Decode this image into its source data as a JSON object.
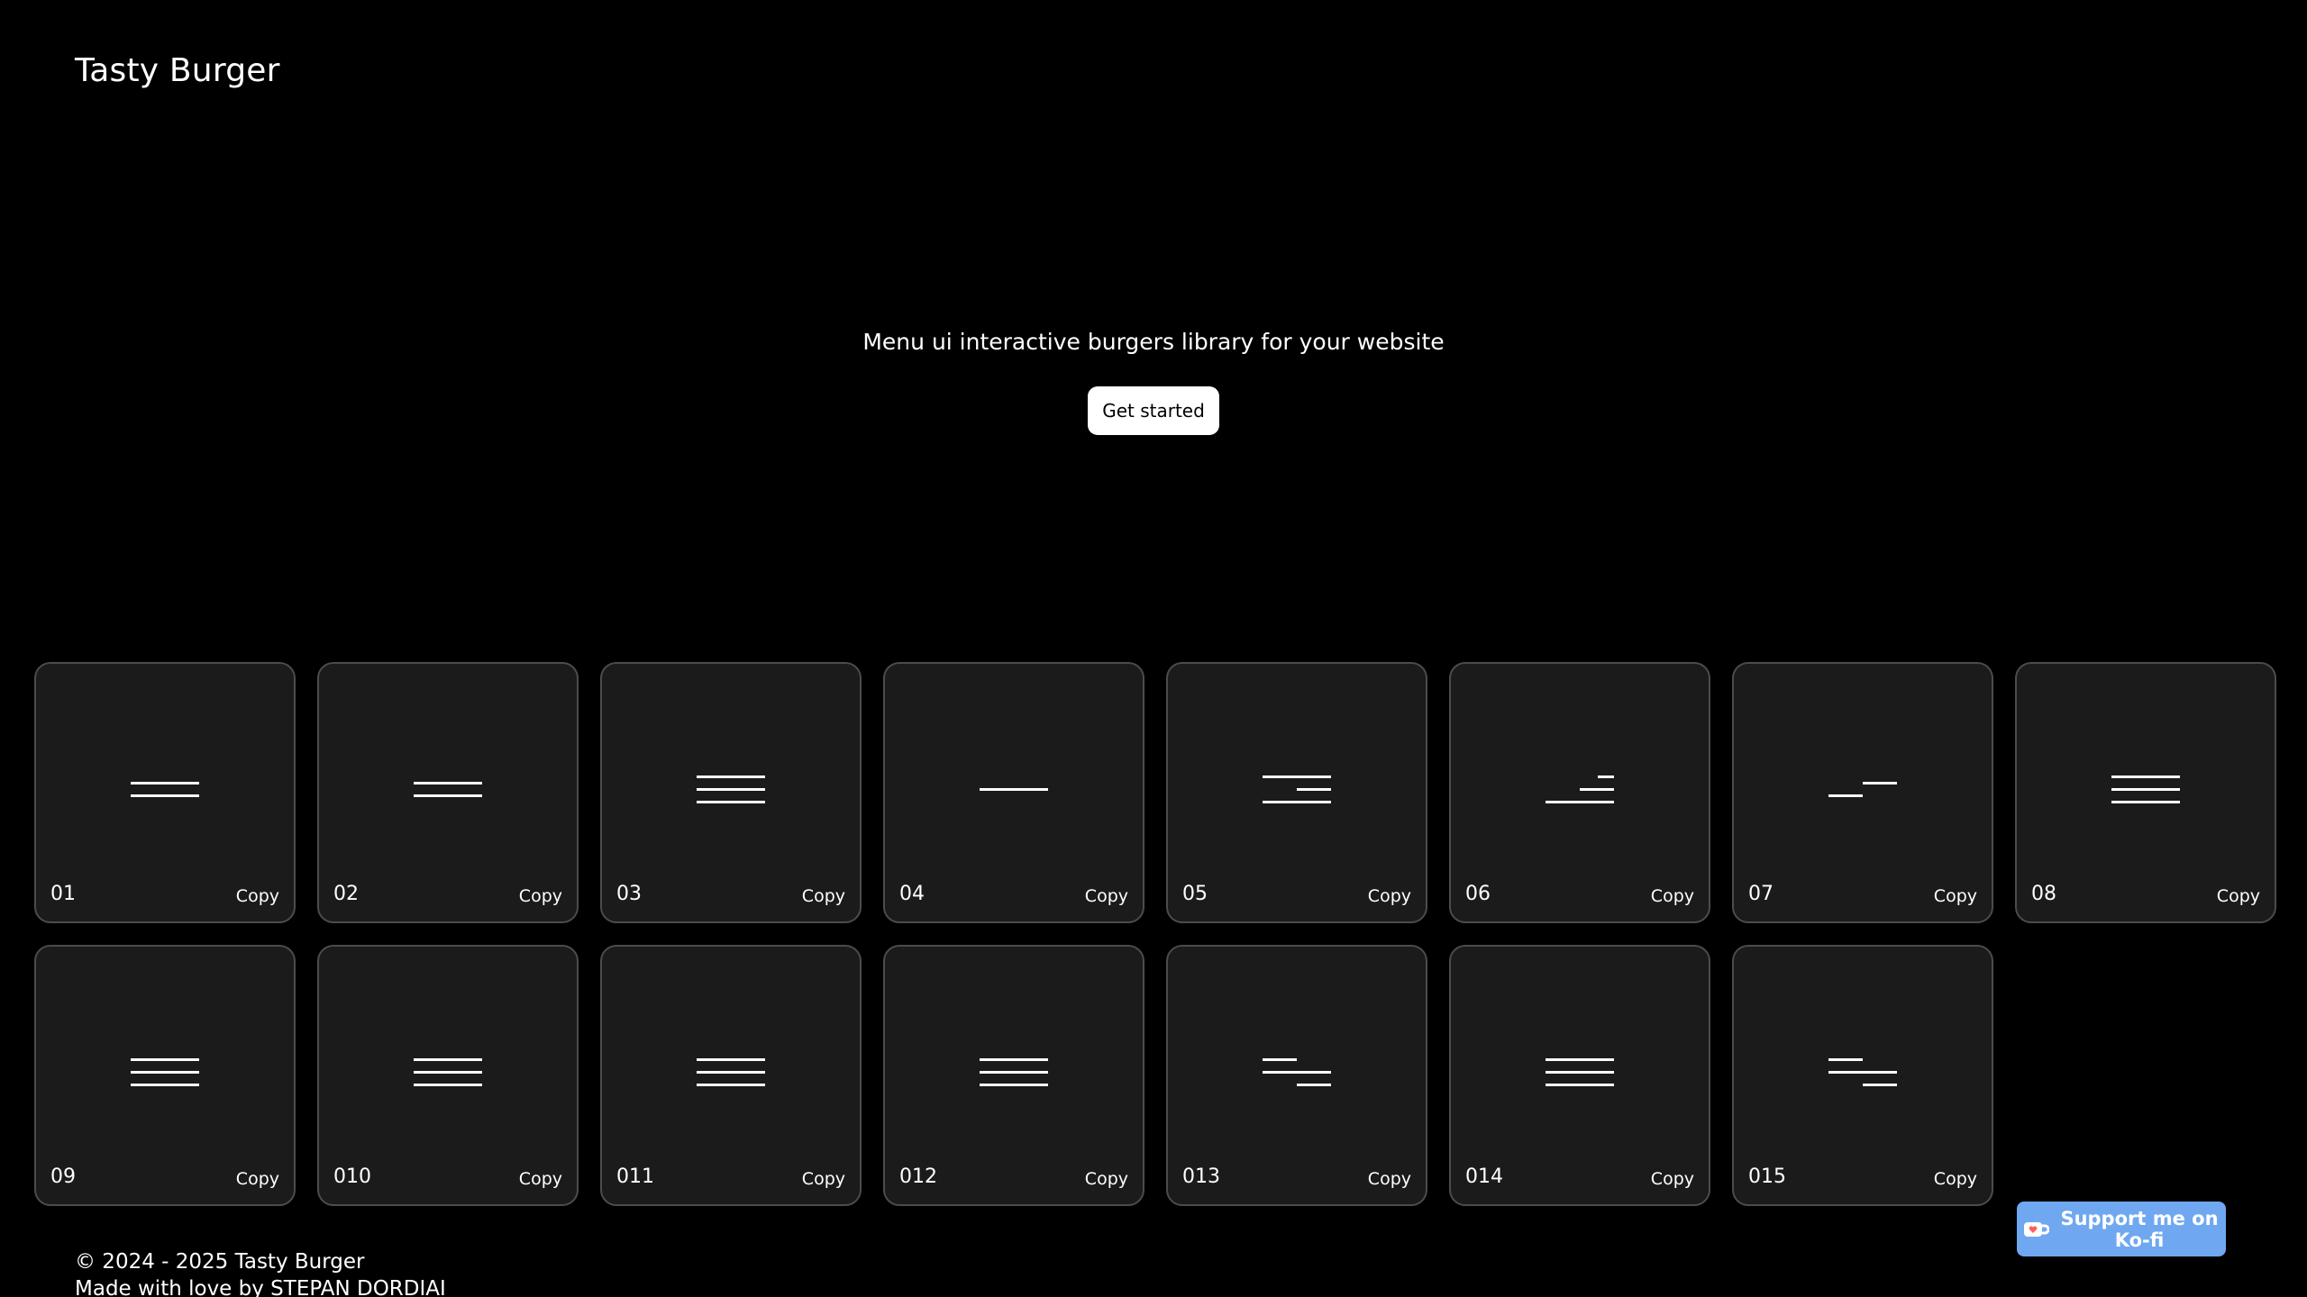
{
  "header": {
    "brand": "Tasty Burger"
  },
  "hero": {
    "tagline": "Menu ui interactive burgers library for your website",
    "cta_label": "Get started"
  },
  "cards": [
    {
      "number": "01",
      "copy_label": "Copy",
      "icon": "burger-two-lines-icon"
    },
    {
      "number": "02",
      "copy_label": "Copy",
      "icon": "burger-two-lines-icon"
    },
    {
      "number": "03",
      "copy_label": "Copy",
      "icon": "burger-three-lines-icon"
    },
    {
      "number": "04",
      "copy_label": "Copy",
      "icon": "burger-single-line-icon"
    },
    {
      "number": "05",
      "copy_label": "Copy",
      "icon": "burger-short-middle-icon"
    },
    {
      "number": "06",
      "copy_label": "Copy",
      "icon": "burger-stairs-icon"
    },
    {
      "number": "07",
      "copy_label": "Copy",
      "icon": "burger-offset-step-icon"
    },
    {
      "number": "08",
      "copy_label": "Copy",
      "icon": "burger-three-lines-icon"
    },
    {
      "number": "09",
      "copy_label": "Copy",
      "icon": "burger-three-lines-icon"
    },
    {
      "number": "010",
      "copy_label": "Copy",
      "icon": "burger-three-lines-icon"
    },
    {
      "number": "011",
      "copy_label": "Copy",
      "icon": "burger-three-lines-icon"
    },
    {
      "number": "012",
      "copy_label": "Copy",
      "icon": "burger-three-lines-icon"
    },
    {
      "number": "013",
      "copy_label": "Copy",
      "icon": "burger-cascade-icon"
    },
    {
      "number": "014",
      "copy_label": "Copy",
      "icon": "burger-three-lines-icon"
    },
    {
      "number": "015",
      "copy_label": "Copy",
      "icon": "burger-cascade-icon"
    }
  ],
  "kofi": {
    "label": "Support me on Ko-fi",
    "icon": "ko-fi-cup-icon",
    "color": "#6fa8f0"
  },
  "footer": {
    "copyright": "© 2024 - 2025 Tasty Burger",
    "credit": "Made with love by STEPAN DORDIAI"
  },
  "colors": {
    "background": "#000000",
    "card_background": "#1b1b1b",
    "card_border": "#4c4c4c"
  }
}
